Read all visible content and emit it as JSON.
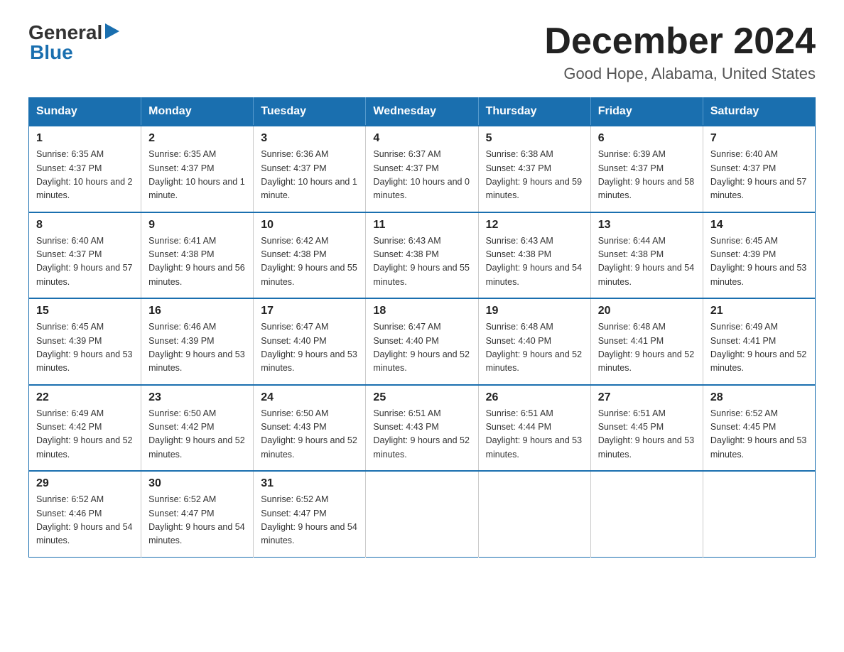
{
  "logo": {
    "text_general": "General",
    "text_blue": "Blue",
    "arrow": "▶"
  },
  "title": "December 2024",
  "subtitle": "Good Hope, Alabama, United States",
  "days_of_week": [
    "Sunday",
    "Monday",
    "Tuesday",
    "Wednesday",
    "Thursday",
    "Friday",
    "Saturday"
  ],
  "weeks": [
    [
      {
        "day": "1",
        "sunrise": "6:35 AM",
        "sunset": "4:37 PM",
        "daylight": "10 hours and 2 minutes."
      },
      {
        "day": "2",
        "sunrise": "6:35 AM",
        "sunset": "4:37 PM",
        "daylight": "10 hours and 1 minute."
      },
      {
        "day": "3",
        "sunrise": "6:36 AM",
        "sunset": "4:37 PM",
        "daylight": "10 hours and 1 minute."
      },
      {
        "day": "4",
        "sunrise": "6:37 AM",
        "sunset": "4:37 PM",
        "daylight": "10 hours and 0 minutes."
      },
      {
        "day": "5",
        "sunrise": "6:38 AM",
        "sunset": "4:37 PM",
        "daylight": "9 hours and 59 minutes."
      },
      {
        "day": "6",
        "sunrise": "6:39 AM",
        "sunset": "4:37 PM",
        "daylight": "9 hours and 58 minutes."
      },
      {
        "day": "7",
        "sunrise": "6:40 AM",
        "sunset": "4:37 PM",
        "daylight": "9 hours and 57 minutes."
      }
    ],
    [
      {
        "day": "8",
        "sunrise": "6:40 AM",
        "sunset": "4:37 PM",
        "daylight": "9 hours and 57 minutes."
      },
      {
        "day": "9",
        "sunrise": "6:41 AM",
        "sunset": "4:38 PM",
        "daylight": "9 hours and 56 minutes."
      },
      {
        "day": "10",
        "sunrise": "6:42 AM",
        "sunset": "4:38 PM",
        "daylight": "9 hours and 55 minutes."
      },
      {
        "day": "11",
        "sunrise": "6:43 AM",
        "sunset": "4:38 PM",
        "daylight": "9 hours and 55 minutes."
      },
      {
        "day": "12",
        "sunrise": "6:43 AM",
        "sunset": "4:38 PM",
        "daylight": "9 hours and 54 minutes."
      },
      {
        "day": "13",
        "sunrise": "6:44 AM",
        "sunset": "4:38 PM",
        "daylight": "9 hours and 54 minutes."
      },
      {
        "day": "14",
        "sunrise": "6:45 AM",
        "sunset": "4:39 PM",
        "daylight": "9 hours and 53 minutes."
      }
    ],
    [
      {
        "day": "15",
        "sunrise": "6:45 AM",
        "sunset": "4:39 PM",
        "daylight": "9 hours and 53 minutes."
      },
      {
        "day": "16",
        "sunrise": "6:46 AM",
        "sunset": "4:39 PM",
        "daylight": "9 hours and 53 minutes."
      },
      {
        "day": "17",
        "sunrise": "6:47 AM",
        "sunset": "4:40 PM",
        "daylight": "9 hours and 53 minutes."
      },
      {
        "day": "18",
        "sunrise": "6:47 AM",
        "sunset": "4:40 PM",
        "daylight": "9 hours and 52 minutes."
      },
      {
        "day": "19",
        "sunrise": "6:48 AM",
        "sunset": "4:40 PM",
        "daylight": "9 hours and 52 minutes."
      },
      {
        "day": "20",
        "sunrise": "6:48 AM",
        "sunset": "4:41 PM",
        "daylight": "9 hours and 52 minutes."
      },
      {
        "day": "21",
        "sunrise": "6:49 AM",
        "sunset": "4:41 PM",
        "daylight": "9 hours and 52 minutes."
      }
    ],
    [
      {
        "day": "22",
        "sunrise": "6:49 AM",
        "sunset": "4:42 PM",
        "daylight": "9 hours and 52 minutes."
      },
      {
        "day": "23",
        "sunrise": "6:50 AM",
        "sunset": "4:42 PM",
        "daylight": "9 hours and 52 minutes."
      },
      {
        "day": "24",
        "sunrise": "6:50 AM",
        "sunset": "4:43 PM",
        "daylight": "9 hours and 52 minutes."
      },
      {
        "day": "25",
        "sunrise": "6:51 AM",
        "sunset": "4:43 PM",
        "daylight": "9 hours and 52 minutes."
      },
      {
        "day": "26",
        "sunrise": "6:51 AM",
        "sunset": "4:44 PM",
        "daylight": "9 hours and 53 minutes."
      },
      {
        "day": "27",
        "sunrise": "6:51 AM",
        "sunset": "4:45 PM",
        "daylight": "9 hours and 53 minutes."
      },
      {
        "day": "28",
        "sunrise": "6:52 AM",
        "sunset": "4:45 PM",
        "daylight": "9 hours and 53 minutes."
      }
    ],
    [
      {
        "day": "29",
        "sunrise": "6:52 AM",
        "sunset": "4:46 PM",
        "daylight": "9 hours and 54 minutes."
      },
      {
        "day": "30",
        "sunrise": "6:52 AM",
        "sunset": "4:47 PM",
        "daylight": "9 hours and 54 minutes."
      },
      {
        "day": "31",
        "sunrise": "6:52 AM",
        "sunset": "4:47 PM",
        "daylight": "9 hours and 54 minutes."
      },
      null,
      null,
      null,
      null
    ]
  ],
  "labels": {
    "sunrise": "Sunrise:",
    "sunset": "Sunset:",
    "daylight": "Daylight:"
  }
}
